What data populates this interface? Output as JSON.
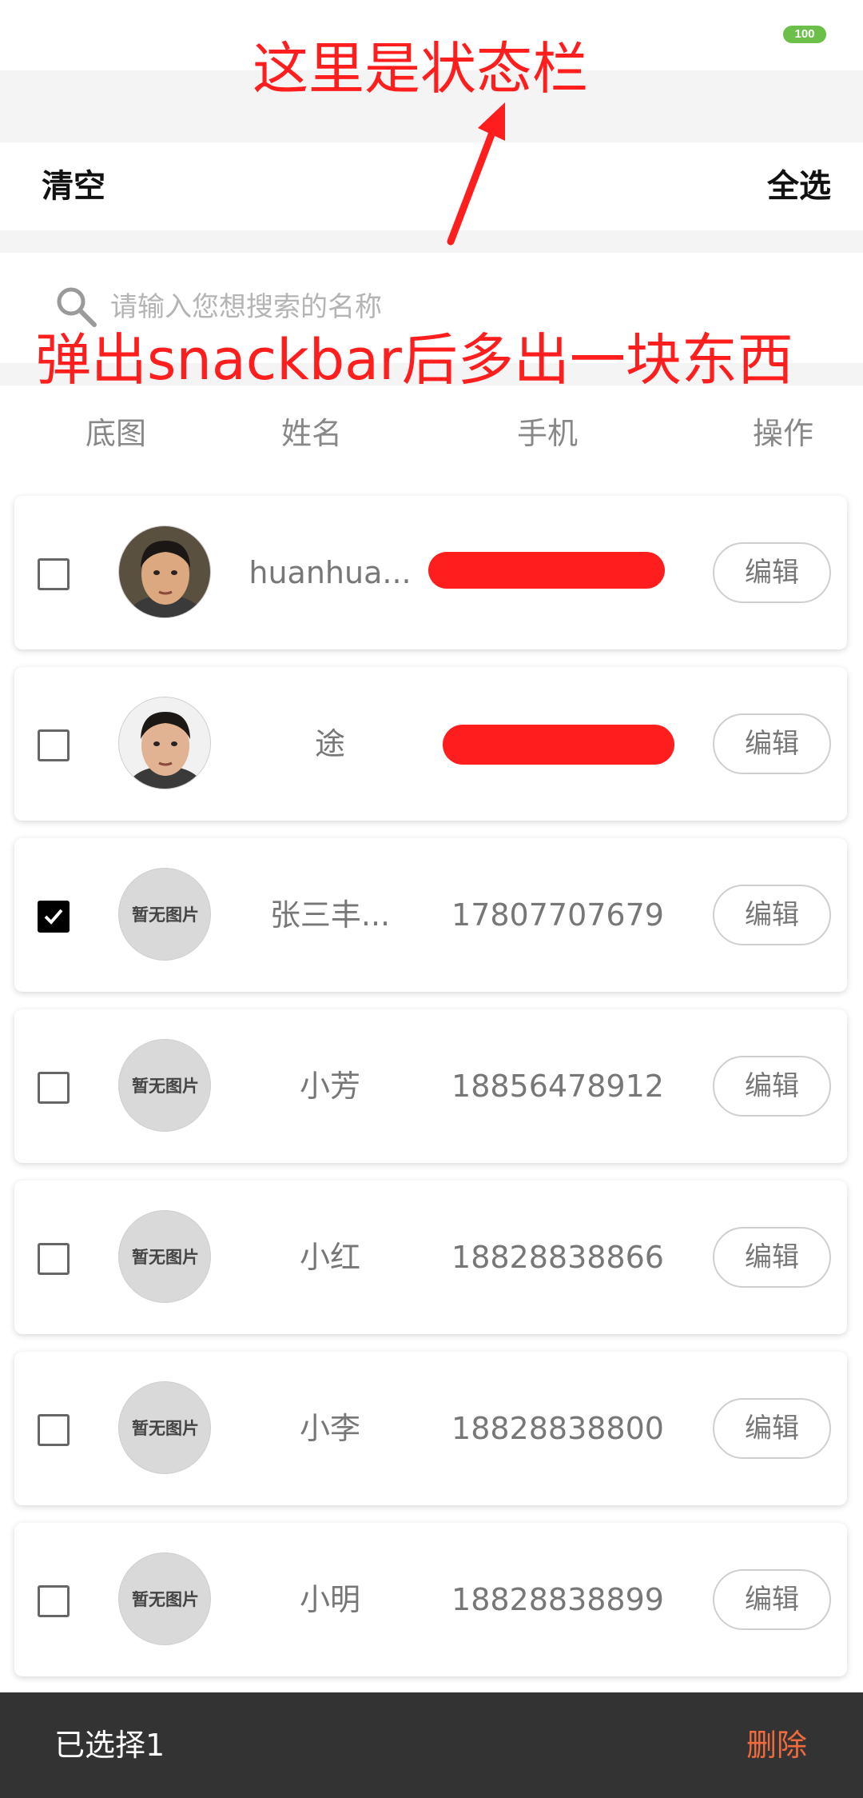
{
  "status_bar": {
    "battery_level": "100",
    "battery_color": "#6cc04a"
  },
  "toolbar": {
    "clear_label": "清空",
    "select_all_label": "全选"
  },
  "search": {
    "placeholder": "请输入您想搜索的名称",
    "value": ""
  },
  "columns": {
    "image": "底图",
    "name": "姓名",
    "phone": "手机",
    "action": "操作"
  },
  "rows": [
    {
      "checked": false,
      "avatar": "photo",
      "avatar_text": "",
      "name": "huanhua...",
      "phone": "",
      "phone_redacted": true,
      "edit_label": "编辑"
    },
    {
      "checked": false,
      "avatar": "photo",
      "avatar_text": "",
      "name": "途",
      "phone": "",
      "phone_redacted": true,
      "edit_label": "编辑"
    },
    {
      "checked": true,
      "avatar": "placeholder",
      "avatar_text": "暂无图片",
      "name": "张三丰...",
      "phone": "17807707679",
      "phone_redacted": false,
      "edit_label": "编辑"
    },
    {
      "checked": false,
      "avatar": "placeholder",
      "avatar_text": "暂无图片",
      "name": "小芳",
      "phone": "18856478912",
      "phone_redacted": false,
      "edit_label": "编辑"
    },
    {
      "checked": false,
      "avatar": "placeholder",
      "avatar_text": "暂无图片",
      "name": "小红",
      "phone": "18828838866",
      "phone_redacted": false,
      "edit_label": "编辑"
    },
    {
      "checked": false,
      "avatar": "placeholder",
      "avatar_text": "暂无图片",
      "name": "小李",
      "phone": "18828838800",
      "phone_redacted": false,
      "edit_label": "编辑"
    },
    {
      "checked": false,
      "avatar": "placeholder",
      "avatar_text": "暂无图片",
      "name": "小明",
      "phone": "18828838899",
      "phone_redacted": false,
      "edit_label": "编辑"
    }
  ],
  "bottom_bar": {
    "selected_label": "已选择1",
    "delete_label": "删除",
    "delete_color": "#f06a3c"
  },
  "annotations": {
    "status_bar_note": "这里是状态栏",
    "snackbar_note": "弹出snackbar后多出一块东西",
    "color": "#ff1e1e"
  }
}
